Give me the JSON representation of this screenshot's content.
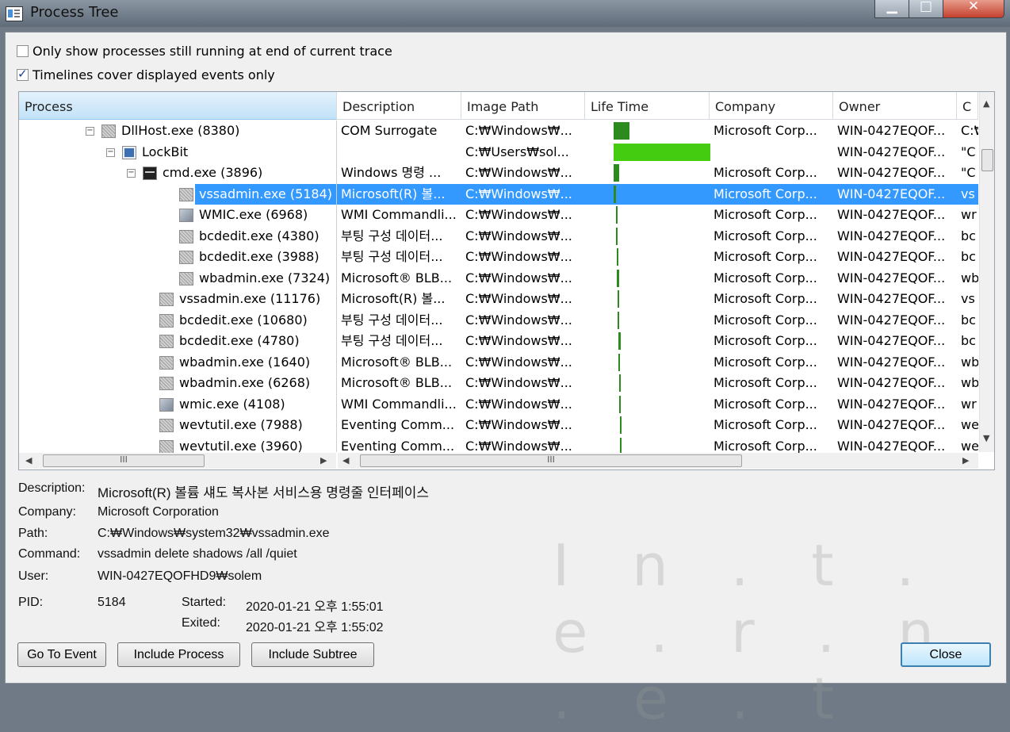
{
  "window": {
    "title": "Process Tree"
  },
  "options": {
    "only_running": {
      "label": "Only show processes still running at end of current trace",
      "checked": false
    },
    "timelines": {
      "label": "Timelines cover displayed events only",
      "checked": true
    }
  },
  "columns": [
    "Process",
    "Description",
    "Image Path",
    "Life Time",
    "Company",
    "Owner",
    "C"
  ],
  "rows": [
    {
      "name": "DllHost.exe (8380)",
      "desc": "COM Surrogate",
      "path": "C:₩Windows₩...",
      "company": "Microsoft Corp...",
      "owner": "WIN-0427EQOF...",
      "cmd": "C:₩"
    },
    {
      "name": "LockBit",
      "desc": "",
      "path": "C:₩Users₩sol...",
      "company": "",
      "owner": "WIN-0427EQOF...",
      "cmd": "\"C"
    },
    {
      "name": "cmd.exe (3896)",
      "desc": "Windows 명령 ...",
      "path": "C:₩Windows₩...",
      "company": "Microsoft Corp...",
      "owner": "WIN-0427EQOF...",
      "cmd": "\"C"
    },
    {
      "name": "vssadmin.exe (5184)",
      "desc": "Microsoft(R) 볼...",
      "path": "C:₩Windows₩...",
      "company": "Microsoft Corp...",
      "owner": "WIN-0427EQOF...",
      "cmd": "vs"
    },
    {
      "name": "WMIC.exe (6968)",
      "desc": "WMI Commandli...",
      "path": "C:₩Windows₩...",
      "company": "Microsoft Corp...",
      "owner": "WIN-0427EQOF...",
      "cmd": "wr"
    },
    {
      "name": "bcdedit.exe (4380)",
      "desc": "부팅 구성 데이터...",
      "path": "C:₩Windows₩...",
      "company": "Microsoft Corp...",
      "owner": "WIN-0427EQOF...",
      "cmd": "bc"
    },
    {
      "name": "bcdedit.exe (3988)",
      "desc": "부팅 구성 데이터...",
      "path": "C:₩Windows₩...",
      "company": "Microsoft Corp...",
      "owner": "WIN-0427EQOF...",
      "cmd": "bc"
    },
    {
      "name": "wbadmin.exe (7324)",
      "desc": "Microsoft® BLB...",
      "path": "C:₩Windows₩...",
      "company": "Microsoft Corp...",
      "owner": "WIN-0427EQOF...",
      "cmd": "wb"
    },
    {
      "name": "vssadmin.exe (11176)",
      "desc": "Microsoft(R) 볼...",
      "path": "C:₩Windows₩...",
      "company": "Microsoft Corp...",
      "owner": "WIN-0427EQOF...",
      "cmd": "vs"
    },
    {
      "name": "bcdedit.exe (10680)",
      "desc": "부팅 구성 데이터...",
      "path": "C:₩Windows₩...",
      "company": "Microsoft Corp...",
      "owner": "WIN-0427EQOF...",
      "cmd": "bc"
    },
    {
      "name": "bcdedit.exe (4780)",
      "desc": "부팅 구성 데이터...",
      "path": "C:₩Windows₩...",
      "company": "Microsoft Corp...",
      "owner": "WIN-0427EQOF...",
      "cmd": "bc"
    },
    {
      "name": "wbadmin.exe (1640)",
      "desc": "Microsoft® BLB...",
      "path": "C:₩Windows₩...",
      "company": "Microsoft Corp...",
      "owner": "WIN-0427EQOF...",
      "cmd": "wb"
    },
    {
      "name": "wbadmin.exe (6268)",
      "desc": "Microsoft® BLB...",
      "path": "C:₩Windows₩...",
      "company": "Microsoft Corp...",
      "owner": "WIN-0427EQOF...",
      "cmd": "wb"
    },
    {
      "name": "wmic.exe (4108)",
      "desc": "WMI Commandli...",
      "path": "C:₩Windows₩...",
      "company": "Microsoft Corp...",
      "owner": "WIN-0427EQOF...",
      "cmd": "wr"
    },
    {
      "name": "wevtutil.exe (7988)",
      "desc": "Eventing Comm...",
      "path": "C:₩Windows₩...",
      "company": "Microsoft Corp...",
      "owner": "WIN-0427EQOF...",
      "cmd": "we"
    },
    {
      "name": "wevtutil.exe (3960)",
      "desc": "Eventing Comm...",
      "path": "C:₩Windows₩...",
      "company": "Microsoft Corp...",
      "owner": "WIN-0427EQOF...",
      "cmd": "we"
    }
  ],
  "details": {
    "description_label": "Description:",
    "description": "Microsoft(R) 볼륨 섀도 복사본 서비스용 명령줄 인터페이스",
    "company_label": "Company:",
    "company": "Microsoft Corporation",
    "path_label": "Path:",
    "path": "C:₩Windows₩system32₩vssadmin.exe",
    "command_label": "Command:",
    "command": "vssadmin  delete shadows /all /quiet",
    "user_label": "User:",
    "user": "WIN-0427EQOFHD9₩solem",
    "pid_label": "PID:",
    "pid": "5184",
    "started_label": "Started:",
    "started": "2020-01-21 오후 1:55:01",
    "exited_label": "Exited:",
    "exited": "2020-01-21 오후 1:55:02"
  },
  "buttons": {
    "go_to_event": "Go To Event",
    "include_process": "Include Process",
    "include_subtree": "Include Subtree",
    "close": "Close"
  },
  "watermark": "I n . t . e . r . n . e . t",
  "colors": {
    "selection": "#3399ff",
    "lifetime": "#2d8a1f",
    "lifetime_bright": "#44cc11"
  },
  "icons": {
    "minimize": "minimize-icon",
    "maximize": "maximize-icon",
    "close": "close-icon"
  }
}
